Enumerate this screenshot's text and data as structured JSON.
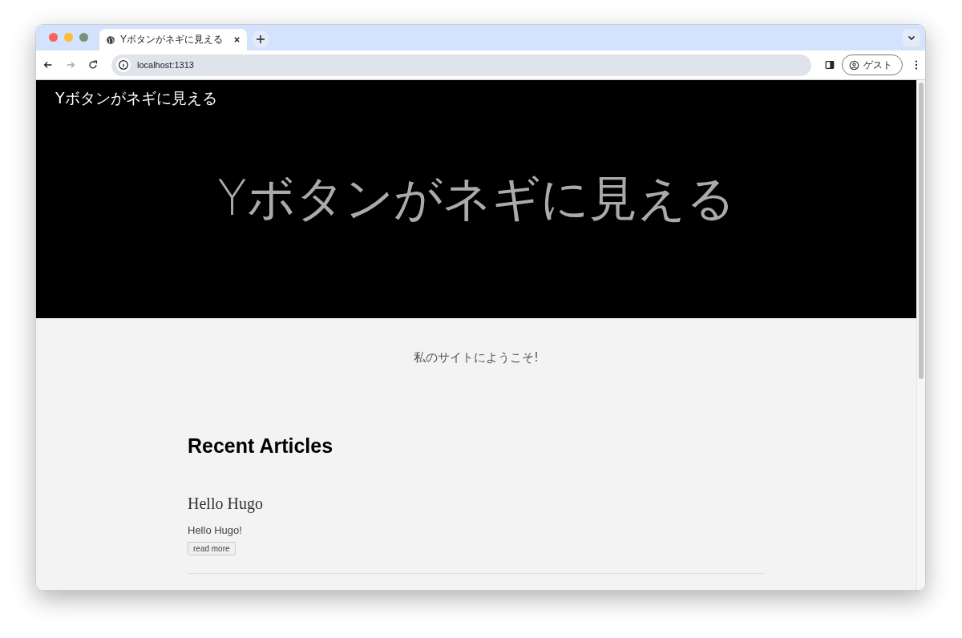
{
  "browser": {
    "tab": {
      "title": "Yボタンがネギに見える",
      "selected": true
    },
    "address": "localhost:1313",
    "profile": "ゲスト"
  },
  "site": {
    "title": "Yボタンがネギに見える",
    "hero_title": "Yボタンがネギに見える",
    "welcome": "私のサイトにようこそ!",
    "section_heading": "Recent Articles",
    "articles": [
      {
        "title": "Hello Hugo",
        "summary": "Hello Hugo!",
        "link": "read more"
      }
    ]
  }
}
